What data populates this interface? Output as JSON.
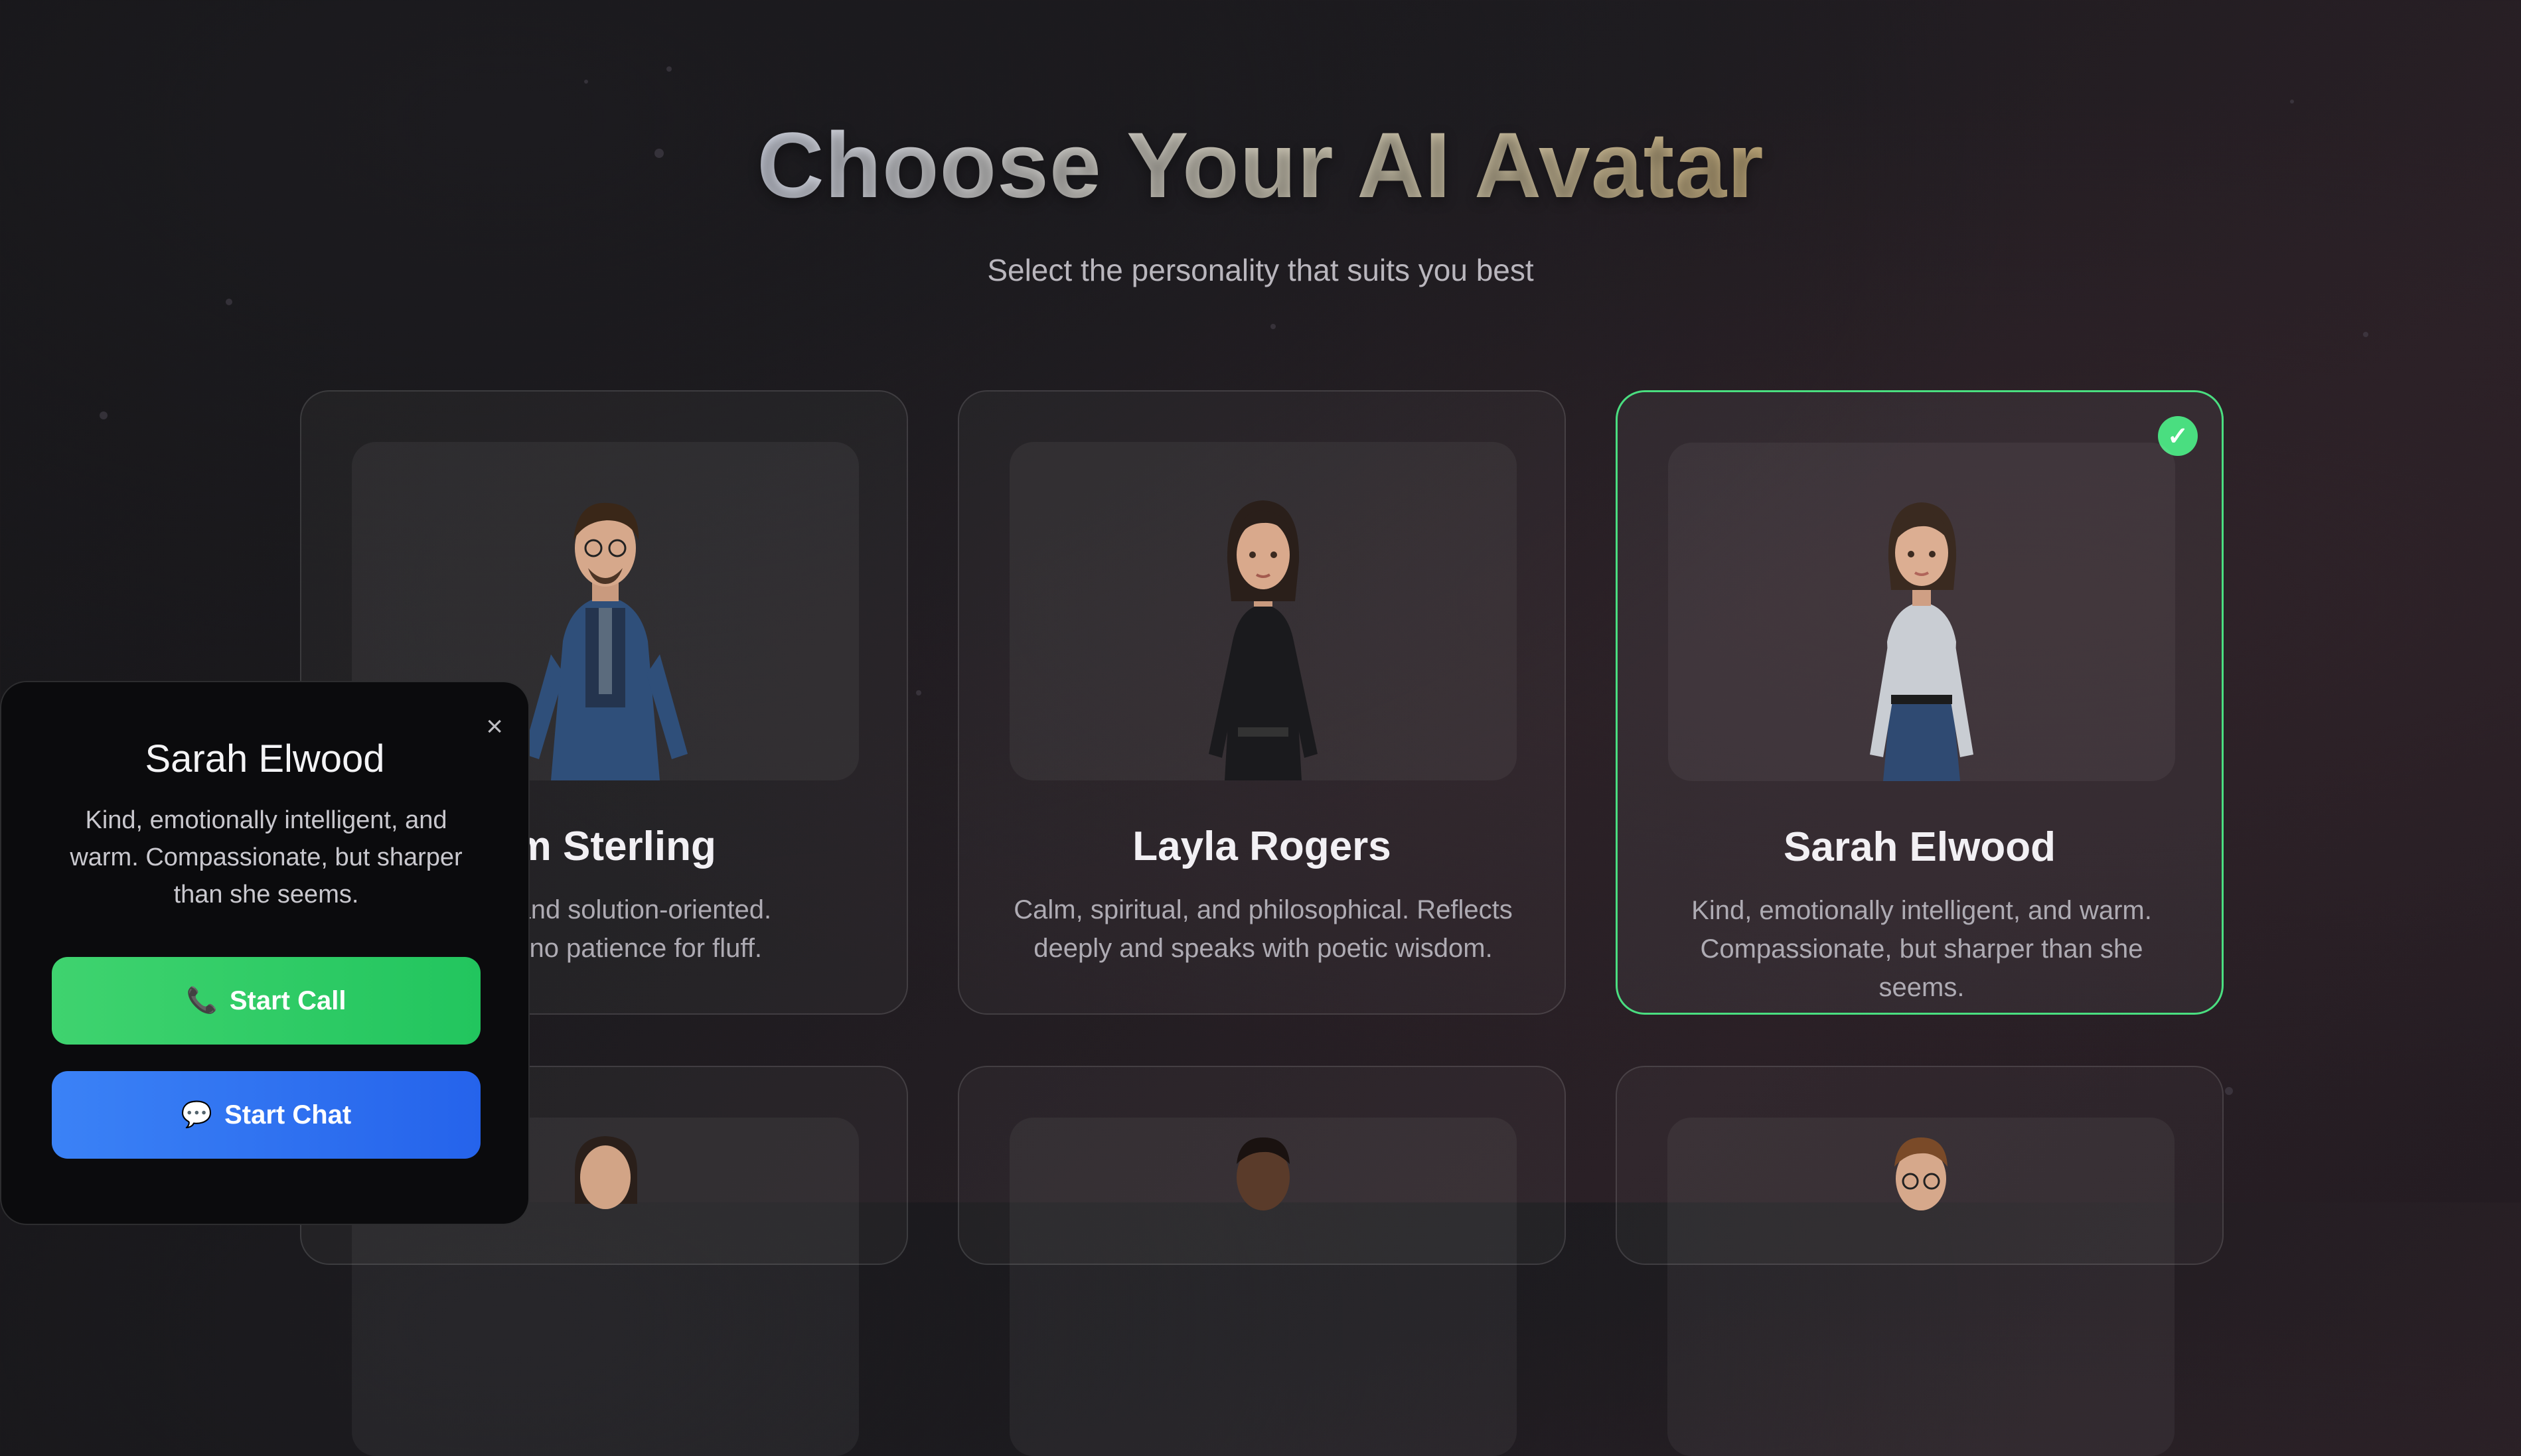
{
  "header": {
    "title": "Choose Your AI Avatar",
    "subtitle": "Select the personality that suits you best"
  },
  "avatars": [
    {
      "name": "am Sterling",
      "desc_line1": "ncise, and solution-oriented.",
      "desc_line2": "y, with no patience for fluff.",
      "selected": false
    },
    {
      "name": "Layla Rogers",
      "desc_line1": "Calm, spiritual, and philosophical. Reflects",
      "desc_line2": "deeply and speaks with poetic wisdom.",
      "selected": false
    },
    {
      "name": "Sarah Elwood",
      "desc_line1": "Kind, emotionally intelligent, and warm.",
      "desc_line2": "Compassionate, but sharper than she seems.",
      "selected": true
    }
  ],
  "selected_check": "✓",
  "popup": {
    "close_label": "×",
    "name": "Sarah Elwood",
    "description": "Kind, emotionally intelligent, and warm. Compassionate, but sharper than she seems.",
    "call_icon": "📞",
    "call_label": "Start Call",
    "chat_icon": "💬",
    "chat_label": "Start Chat"
  },
  "colors": {
    "accent_green": "#4ade80",
    "call_button": "#22c55e",
    "chat_button": "#2563eb"
  }
}
